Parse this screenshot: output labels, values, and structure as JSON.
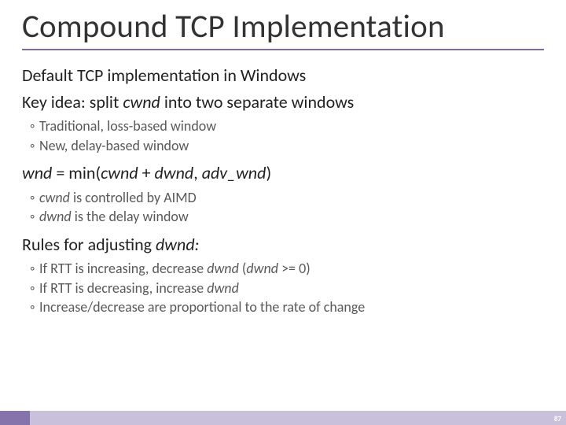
{
  "title": "Compound TCP Implementation",
  "lines": {
    "l1": "Default TCP implementation in Windows",
    "l2_a": "Key idea: split ",
    "l2_em": "cwnd",
    "l2_b": " into two separate windows",
    "s1": "Traditional, loss-based window",
    "s2": "New, delay-based window",
    "l3_a": "wnd",
    "l3_b": " = min(",
    "l3_c": "cwnd",
    "l3_d": " + ",
    "l3_e": "dwnd",
    "l3_f": ", ",
    "l3_g": "adv_wnd",
    "l3_h": ")",
    "s3_a": "cwnd",
    "s3_b": " is controlled by AIMD",
    "s4_a": "dwnd",
    "s4_b": " is the delay window",
    "l4_a": "Rules for adjusting ",
    "l4_b": "dwnd:",
    "s5_a": "If RTT is increasing, decrease ",
    "s5_b": "dwnd",
    "s5_c": " (",
    "s5_d": "dwnd",
    "s5_e": " >= 0)",
    "s6_a": "If RTT is decreasing, increase ",
    "s6_b": "dwnd",
    "s7": "Increase/decrease are proportional to the rate of change"
  },
  "bullet": "◦ ",
  "page_number": "87"
}
